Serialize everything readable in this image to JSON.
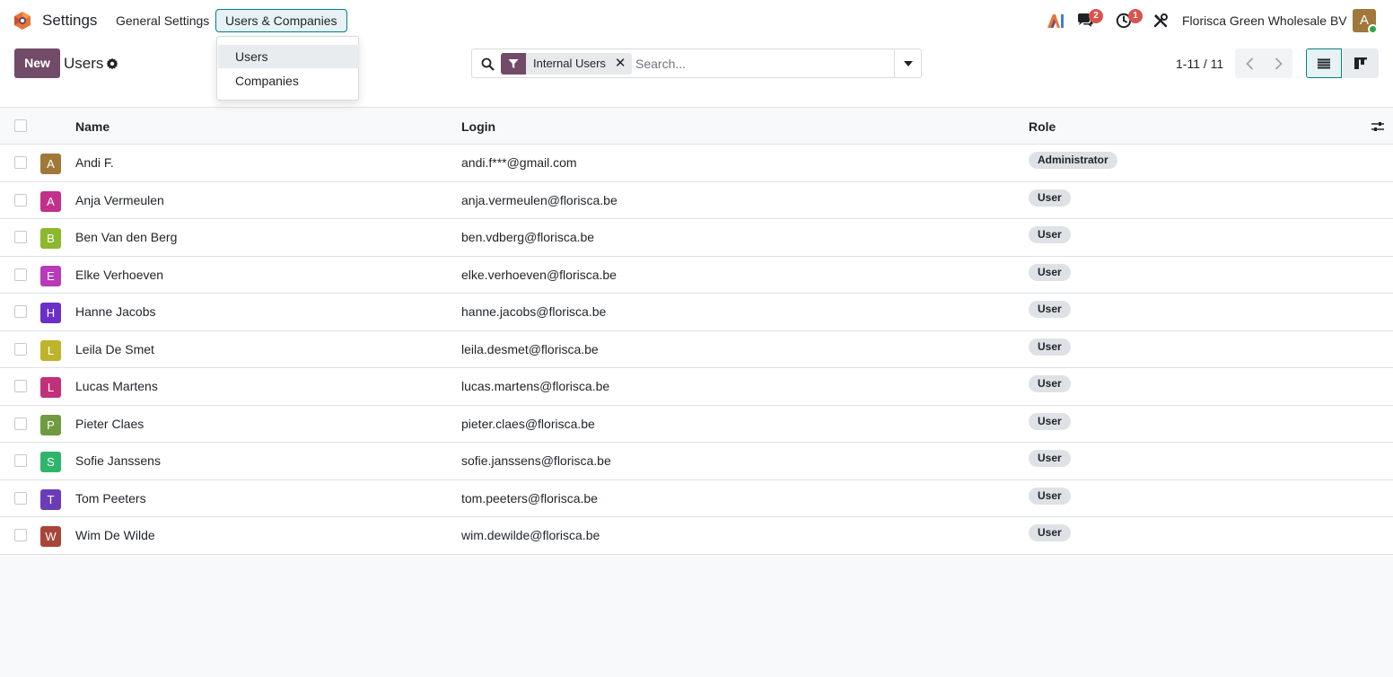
{
  "navbar": {
    "app_name": "Settings",
    "menus": [
      "General Settings",
      "Users & Companies"
    ],
    "chat_badge": "2",
    "activity_badge": "1",
    "company": "Florisca Green Wholesale BV",
    "user_initial": "A",
    "icons": [
      "odoo-app-icon",
      "ai-icon",
      "chat-icon",
      "activity-clock-icon",
      "tools-icon"
    ]
  },
  "dropdown": {
    "items": [
      "Users",
      "Companies"
    ]
  },
  "control_panel": {
    "new_label": "New",
    "breadcrumb": "Users",
    "search": {
      "facet": "Internal Users",
      "placeholder": "Search..."
    },
    "pager": "1-11 / 11"
  },
  "table": {
    "columns": [
      "Name",
      "Login",
      "Role"
    ],
    "rows": [
      {
        "initial": "A",
        "name": "Andi F.",
        "login": "andi.f***@gmail.com",
        "role": "Administrator",
        "color": "#a0783a"
      },
      {
        "initial": "A",
        "name": "Anja Vermeulen",
        "login": "anja.vermeulen@florisca.be",
        "role": "User",
        "color": "#c2308a"
      },
      {
        "initial": "B",
        "name": "Ben Van den Berg",
        "login": "ben.vdberg@florisca.be",
        "role": "User",
        "color": "#8cb82d"
      },
      {
        "initial": "E",
        "name": "Elke Verhoeven",
        "login": "elke.verhoeven@florisca.be",
        "role": "User",
        "color": "#b83ab8"
      },
      {
        "initial": "H",
        "name": "Hanne Jacobs",
        "login": "hanne.jacobs@florisca.be",
        "role": "User",
        "color": "#6b2fc9"
      },
      {
        "initial": "L",
        "name": "Leila De Smet",
        "login": "leila.desmet@florisca.be",
        "role": "User",
        "color": "#bdb42a"
      },
      {
        "initial": "L",
        "name": "Lucas Martens",
        "login": "lucas.martens@florisca.be",
        "role": "User",
        "color": "#c2307a"
      },
      {
        "initial": "P",
        "name": "Pieter Claes",
        "login": "pieter.claes@florisca.be",
        "role": "User",
        "color": "#6f9a3f"
      },
      {
        "initial": "S",
        "name": "Sofie Janssens",
        "login": "sofie.janssens@florisca.be",
        "role": "User",
        "color": "#2fb56a"
      },
      {
        "initial": "T",
        "name": "Tom Peeters",
        "login": "tom.peeters@florisca.be",
        "role": "User",
        "color": "#6a3db8"
      },
      {
        "initial": "W",
        "name": "Wim De Wilde",
        "login": "wim.dewilde@florisca.be",
        "role": "User",
        "color": "#a8453a"
      }
    ]
  },
  "colors": {
    "primary": "#714b67",
    "accent": "#017e84",
    "badge": "#d9534f"
  }
}
